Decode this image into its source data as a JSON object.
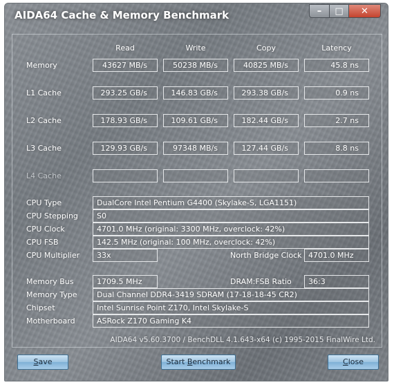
{
  "window": {
    "title": "AIDA64 Cache & Memory Benchmark",
    "minimize_glyph": "–",
    "maximize_glyph": "□",
    "close_glyph": "✕"
  },
  "columns": [
    "Read",
    "Write",
    "Copy",
    "Latency"
  ],
  "bench_rows": [
    {
      "label": "Memory",
      "values": [
        "43627 MB/s",
        "50238 MB/s",
        "40825 MB/s",
        "45.8 ns"
      ]
    },
    {
      "label": "L1 Cache",
      "values": [
        "293.25 GB/s",
        "146.83 GB/s",
        "293.38 GB/s",
        "0.9 ns"
      ]
    },
    {
      "label": "L2 Cache",
      "values": [
        "178.93 GB/s",
        "109.61 GB/s",
        "182.44 GB/s",
        "2.7 ns"
      ]
    },
    {
      "label": "L3 Cache",
      "values": [
        "129.93 GB/s",
        "97348 MB/s",
        "127.44 GB/s",
        "8.8 ns"
      ]
    },
    {
      "label": "L4 Cache",
      "values": [
        "",
        "",
        "",
        ""
      ]
    }
  ],
  "info": {
    "cpu_type_label": "CPU Type",
    "cpu_type": "DualCore Intel Pentium G4400  (Skylake-S, LGA1151)",
    "cpu_stepping_label": "CPU Stepping",
    "cpu_stepping": "S0",
    "cpu_clock_label": "CPU Clock",
    "cpu_clock": "4701.0 MHz  (original: 3300 MHz, overclock: 42%)",
    "cpu_fsb_label": "CPU FSB",
    "cpu_fsb": "142.5 MHz  (original: 100 MHz, overclock: 42%)",
    "cpu_multiplier_label": "CPU Multiplier",
    "cpu_multiplier": "33x",
    "nb_clock_label": "North Bridge Clock",
    "nb_clock": "4701.0 MHz",
    "memory_bus_label": "Memory Bus",
    "memory_bus": "1709.5 MHz",
    "dram_fsb_label": "DRAM:FSB Ratio",
    "dram_fsb": "36:3",
    "memory_type_label": "Memory Type",
    "memory_type": "Dual Channel DDR4-3419 SDRAM  (17-18-18-45 CR2)",
    "chipset_label": "Chipset",
    "chipset": "Intel Sunrise Point Z170, Intel Skylake-S",
    "motherboard_label": "Motherboard",
    "motherboard": "ASRock Z170 Gaming K4"
  },
  "version_note": "AIDA64 v5.60.3700 / BenchDLL 4.1.643-x64  (c) 1995-2015 FinalWire Ltd.",
  "buttons": {
    "save_underlined": "S",
    "save_rest": "ave",
    "start_pre": "Start ",
    "start_underlined": "B",
    "start_rest": "enchmark",
    "close_underlined": "C",
    "close_rest": "lose"
  }
}
